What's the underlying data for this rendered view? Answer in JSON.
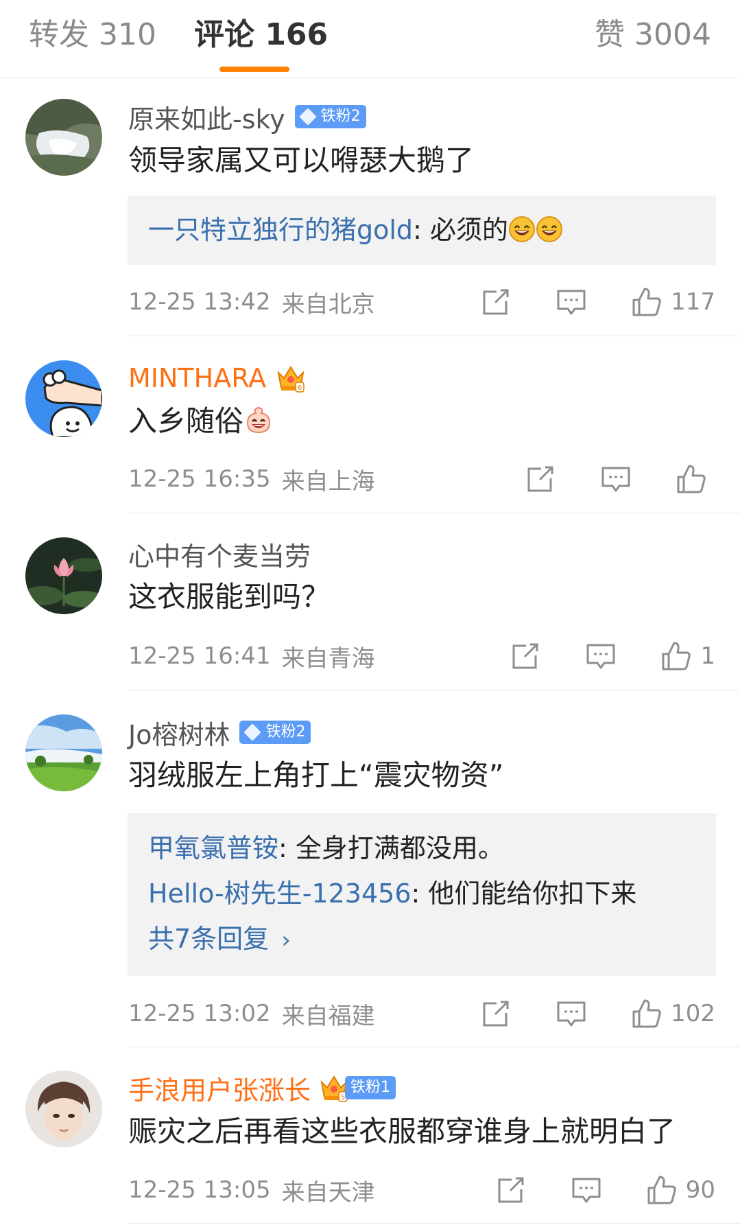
{
  "tabs": {
    "repost": "转发 310",
    "comments": "评论 166",
    "likes": "赞 3004",
    "accent_color": "#ff8200"
  },
  "comments": [
    {
      "username": "原来如此-sky",
      "fan_badge": "铁粉2",
      "text": "领导家属又可以嘚瑟大鹅了",
      "replies": [
        {
          "user": "一只特立独行的猪gold",
          "text": ": 必须的"
        }
      ],
      "time": "12-25 13:42",
      "location": "来自北京",
      "likes": "117"
    },
    {
      "username": "MINTHARA",
      "crown_badge": "crown-icon",
      "text": "入乡随俗",
      "time": "12-25 16:35",
      "location": "来自上海",
      "likes": ""
    },
    {
      "username": "心中有个麦当劳",
      "text": "这衣服能到吗？",
      "time": "12-25 16:41",
      "location": "来自青海",
      "likes": "1"
    },
    {
      "username": "Jo榕树林",
      "fan_badge": "铁粉2",
      "text": "羽绒服左上角打上“震灾物资”",
      "replies": [
        {
          "user": "甲氧氯普铵",
          "text": ": 全身打满都没用。"
        },
        {
          "user": "Hello-树先生-123456",
          "text": ": 他们能给你扣下来"
        }
      ],
      "more_replies": "共7条回复",
      "time": "12-25 13:02",
      "location": "来自福建",
      "likes": "102"
    },
    {
      "username": "手浪用户张涨长",
      "fan_badge": "铁粉1",
      "text": "赈灾之后再看这些衣服都穿谁身上就明白了",
      "time": "12-25 13:05",
      "location": "来自天津",
      "likes": "90"
    }
  ],
  "colors": {
    "reply_user": "#3a6fae",
    "fan_badge": "#5c9bf6",
    "vip_name": "#ff6f14",
    "meta_gray": "#8e8e8e"
  }
}
